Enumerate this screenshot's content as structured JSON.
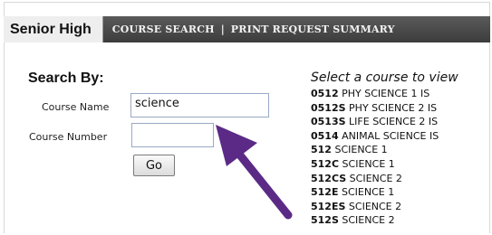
{
  "tabs": {
    "active": "Senior High",
    "links": [
      "COURSE SEARCH",
      "PRINT REQUEST SUMMARY"
    ],
    "separator": "|"
  },
  "search": {
    "title": "Search By:",
    "course_name_label": "Course Name",
    "course_name_value": "science",
    "course_number_label": "Course Number",
    "course_number_value": "",
    "go_label": "Go"
  },
  "results": {
    "prompt": "Select a course to view",
    "courses": [
      {
        "code": "0512",
        "title": "PHY SCIENCE 1 IS"
      },
      {
        "code": "0512S",
        "title": "PHY SCIENCE 2 IS"
      },
      {
        "code": "0513S",
        "title": "LIFE SCIENCE 2 IS"
      },
      {
        "code": "0514",
        "title": "ANIMAL SCIENCE IS"
      },
      {
        "code": "512",
        "title": "SCIENCE 1"
      },
      {
        "code": "512C",
        "title": "SCIENCE 1"
      },
      {
        "code": "512CS",
        "title": "SCIENCE 2"
      },
      {
        "code": "512E",
        "title": "SCIENCE 1"
      },
      {
        "code": "512ES",
        "title": "SCIENCE 2"
      },
      {
        "code": "512S",
        "title": "SCIENCE 2"
      }
    ]
  },
  "colors": {
    "tabbar": "#4a4a4a",
    "active_tab": "#eeeeee",
    "arrow": "#5b2a86"
  },
  "annotation_icon": "arrow-pointer-icon"
}
